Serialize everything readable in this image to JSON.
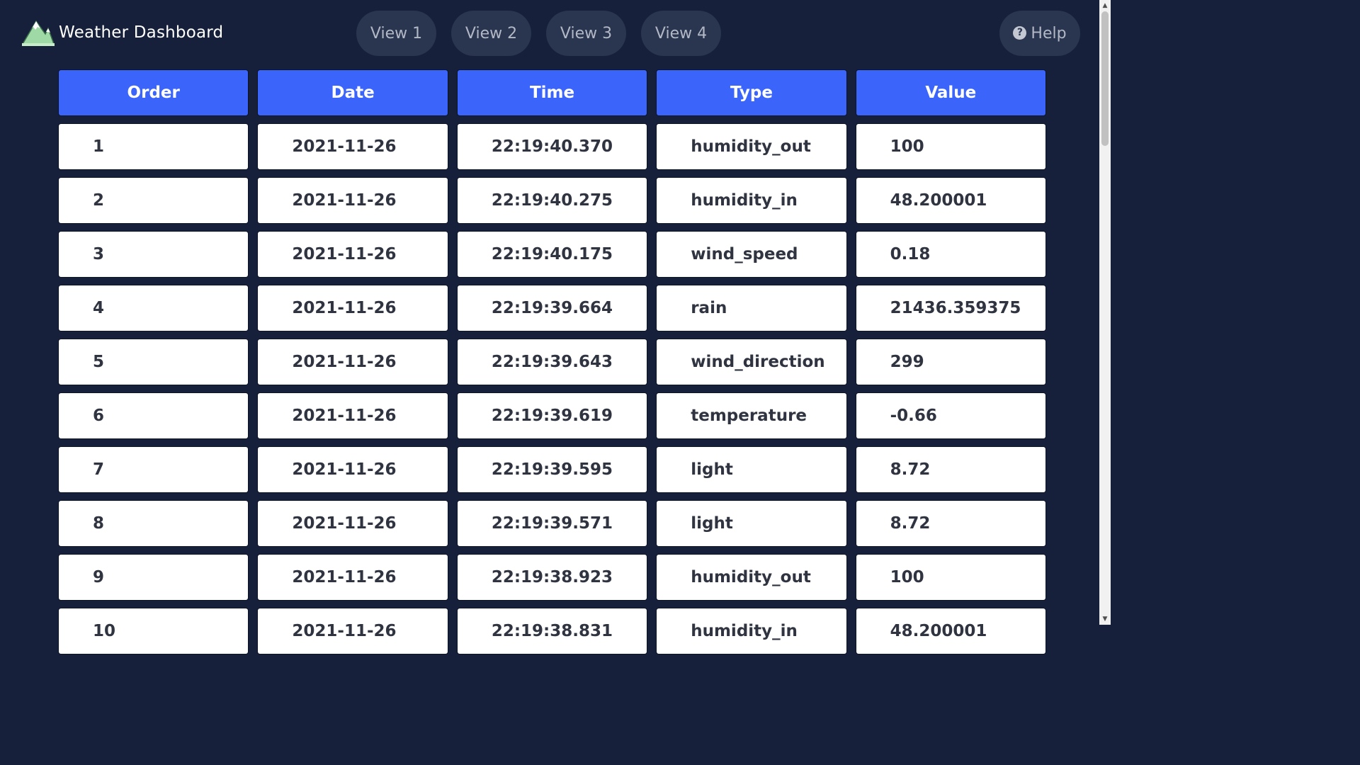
{
  "app": {
    "title": "Weather Dashboard",
    "logo_icon": "mountain-logo-icon"
  },
  "nav": {
    "views": [
      "View 1",
      "View 2",
      "View 3",
      "View 4"
    ],
    "help_label": "Help",
    "help_icon": "question-circle-icon"
  },
  "table": {
    "columns": [
      "Order",
      "Date",
      "Time",
      "Type",
      "Value"
    ],
    "rows": [
      [
        "1",
        "2021-11-26",
        "22:19:40.370",
        "humidity_out",
        "100"
      ],
      [
        "2",
        "2021-11-26",
        "22:19:40.275",
        "humidity_in",
        "48.200001"
      ],
      [
        "3",
        "2021-11-26",
        "22:19:40.175",
        "wind_speed",
        "0.18"
      ],
      [
        "4",
        "2021-11-26",
        "22:19:39.664",
        "rain",
        "21436.359375"
      ],
      [
        "5",
        "2021-11-26",
        "22:19:39.643",
        "wind_direction",
        "299"
      ],
      [
        "6",
        "2021-11-26",
        "22:19:39.619",
        "temperature",
        "-0.66"
      ],
      [
        "7",
        "2021-11-26",
        "22:19:39.595",
        "light",
        "8.72"
      ],
      [
        "8",
        "2021-11-26",
        "22:19:39.571",
        "light",
        "8.72"
      ],
      [
        "9",
        "2021-11-26",
        "22:19:38.923",
        "humidity_out",
        "100"
      ],
      [
        "10",
        "2021-11-26",
        "22:19:38.831",
        "humidity_in",
        "48.200001"
      ]
    ]
  },
  "colors": {
    "background": "#16203a",
    "header_cell": "#3b64fb",
    "nav_pill": "#2a3550"
  }
}
